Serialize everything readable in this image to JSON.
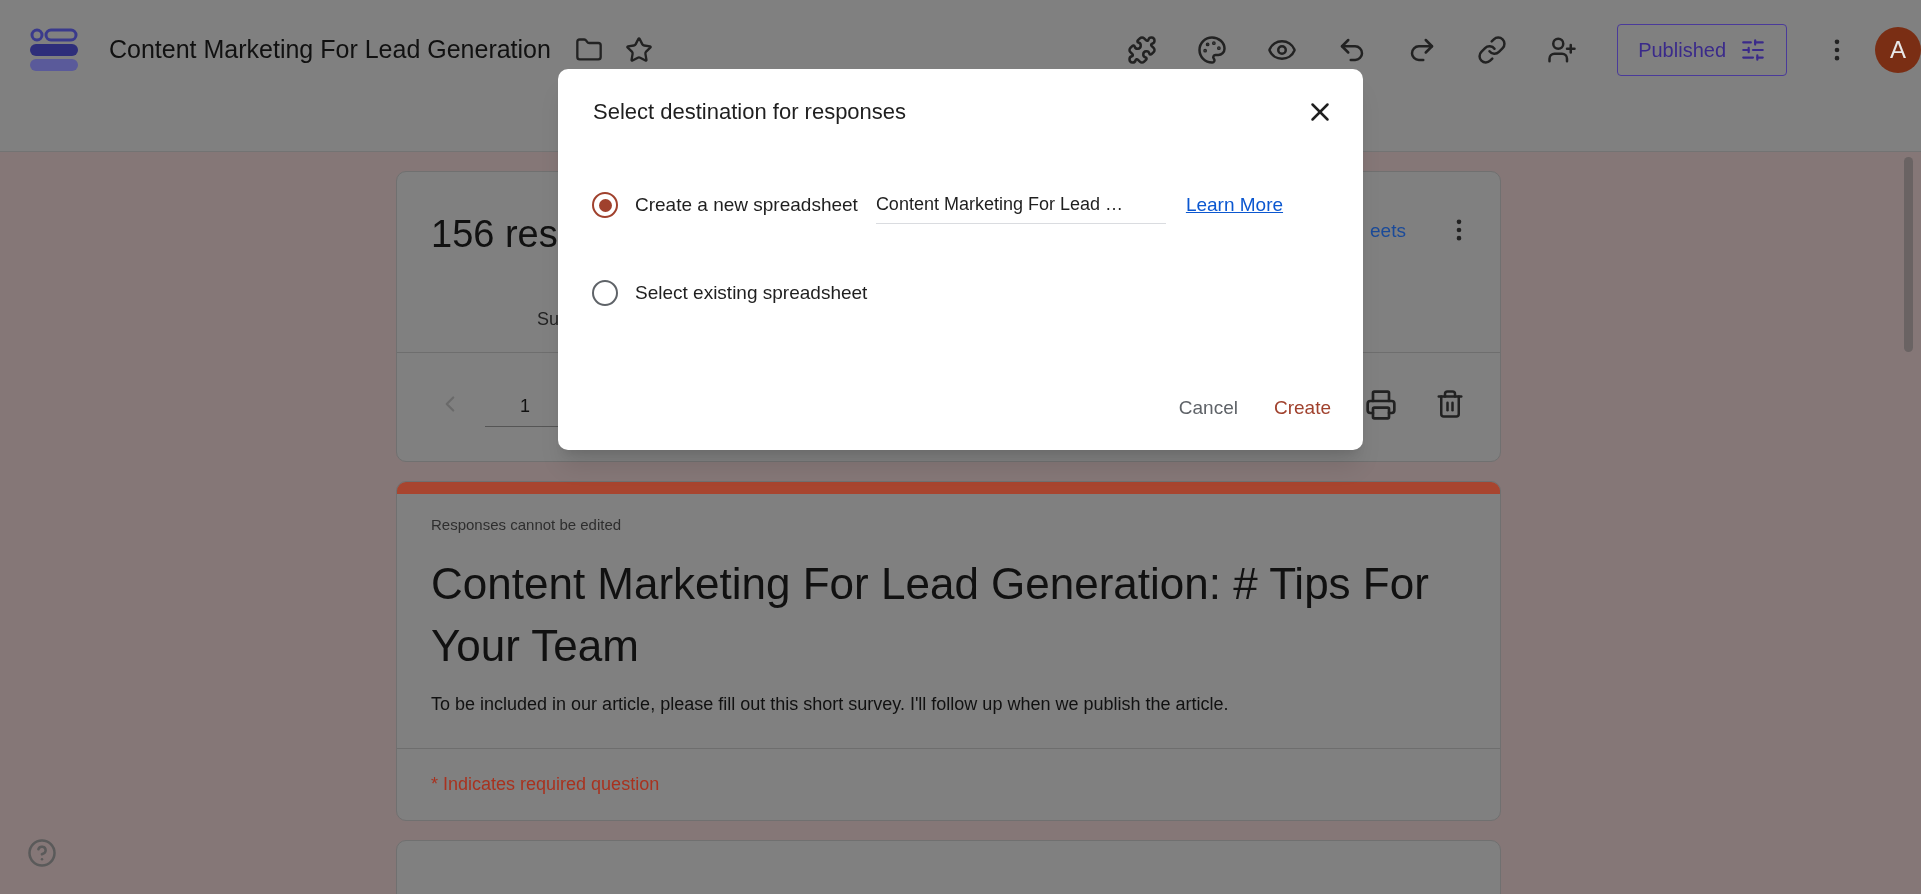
{
  "header": {
    "title": "Content Marketing For Lead Generation",
    "publish_button": "Published",
    "avatar": "A"
  },
  "responses_card": {
    "count": "156 res",
    "tab": "Su",
    "link": "eets",
    "page": "1"
  },
  "form_card": {
    "note": "Responses cannot be edited",
    "title": "Content Marketing For Lead Generation: # Tips For Your Team",
    "description": "To be included in our article, please fill out this short survey. I'll follow up when we publish the article.",
    "required_note": "* Indicates required question"
  },
  "dialog": {
    "title": "Select destination for responses",
    "options": [
      {
        "label": "Create a new spreadsheet",
        "selected": true,
        "field_value": "Content Marketing For Lead …",
        "link": "Learn More"
      },
      {
        "label": "Select existing spreadsheet",
        "selected": false
      }
    ],
    "buttons": [
      "Cancel",
      "Create"
    ]
  }
}
